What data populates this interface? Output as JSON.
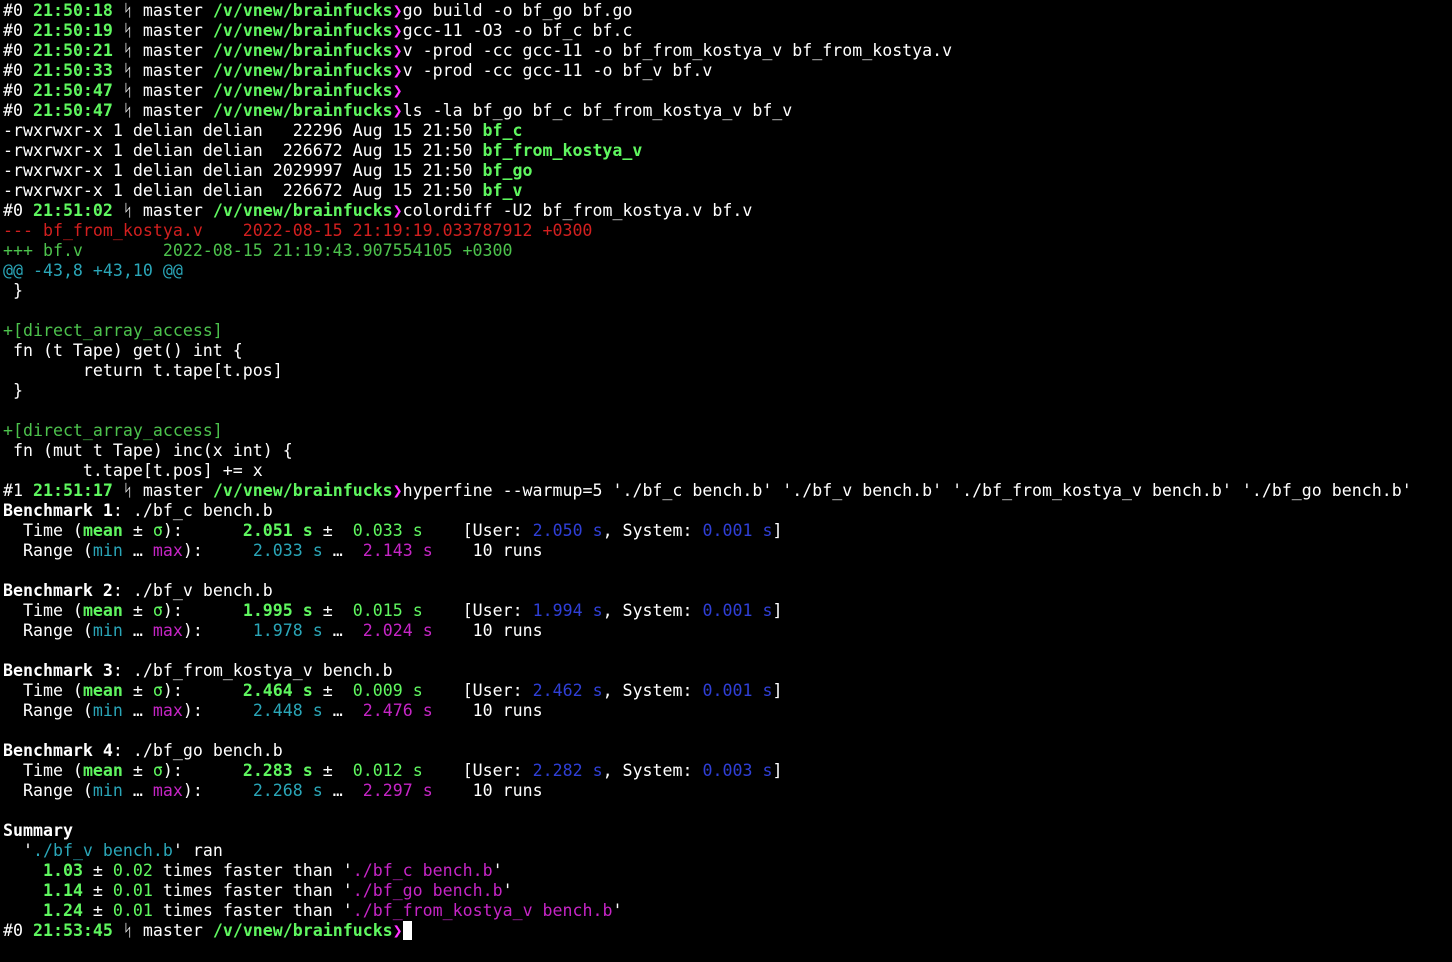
{
  "prompt": {
    "branch_icon": "ᛋ",
    "branch": "master",
    "path": "/v/vnew/brainfucks",
    "arrow": "❯"
  },
  "cmd1": {
    "num": "#0",
    "time": "21:50:18",
    "cmd": "go build -o bf_go bf.go"
  },
  "cmd2": {
    "num": "#0",
    "time": "21:50:19",
    "cmd": "gcc-11 -O3 -o bf_c bf.c"
  },
  "cmd3": {
    "num": "#0",
    "time": "21:50:21",
    "cmd": "v -prod -cc gcc-11 -o bf_from_kostya_v bf_from_kostya.v"
  },
  "cmd4": {
    "num": "#0",
    "time": "21:50:33",
    "cmd": "v -prod -cc gcc-11 -o bf_v bf.v"
  },
  "cmd5": {
    "num": "#0",
    "time": "21:50:47",
    "cmd": ""
  },
  "cmd6": {
    "num": "#0",
    "time": "21:50:47",
    "cmd": "ls -la bf_go bf_c bf_from_kostya_v bf_v"
  },
  "ls": [
    {
      "meta": "-rwxrwxr-x 1 delian delian   22296 Aug 15 21:50 ",
      "name": "bf_c"
    },
    {
      "meta": "-rwxrwxr-x 1 delian delian  226672 Aug 15 21:50 ",
      "name": "bf_from_kostya_v"
    },
    {
      "meta": "-rwxrwxr-x 1 delian delian 2029997 Aug 15 21:50 ",
      "name": "bf_go"
    },
    {
      "meta": "-rwxrwxr-x 1 delian delian  226672 Aug 15 21:50 ",
      "name": "bf_v"
    }
  ],
  "cmd7": {
    "num": "#0",
    "time": "21:51:02",
    "cmd": "colordiff -U2 bf_from_kostya.v bf.v"
  },
  "diff": {
    "minus": "--- bf_from_kostya.v    2022-08-15 21:19:19.033787912 +0300",
    "plus": "+++ bf.v        2022-08-15 21:19:43.907554105 +0300",
    "hunk": "@@ -43,8 +43,10 @@",
    "l1": " }",
    "l2": "",
    "add1": "+[direct_array_access]",
    "l3": " fn (t Tape) get() int {",
    "l4": "        return t.tape[t.pos]",
    "l5": " }",
    "l6": "",
    "add2": "+[direct_array_access]",
    "l7": " fn (mut t Tape) inc(x int) {",
    "l8": "        t.tape[t.pos] += x"
  },
  "cmd8": {
    "num": "#1",
    "time": "21:51:17",
    "cmd": "hyperfine --warmup=5 './bf_c bench.b' './bf_v bench.b' './bf_from_kostya_v bench.b' './bf_go bench.b'"
  },
  "bench_labels": {
    "benchmark": "Benchmark",
    "time": "  Time (",
    "mean": "mean",
    "pm": " ± ",
    "sigma": "σ",
    "close": "):",
    "range": "  Range (",
    "min": "min",
    "ell": " … ",
    "max": "max",
    "user": "[User: ",
    "system": ", System: ",
    "unit": "s",
    "runs": "runs"
  },
  "benchmarks": [
    {
      "n": "1",
      "cmd": "./bf_c bench.b",
      "mean": "2.051",
      "sigma": "0.033",
      "user": "2.050",
      "system": "0.001",
      "min": "2.033",
      "max": "2.143",
      "runs": "10"
    },
    {
      "n": "2",
      "cmd": "./bf_v bench.b",
      "mean": "1.995",
      "sigma": "0.015",
      "user": "1.994",
      "system": "0.001",
      "min": "1.978",
      "max": "2.024",
      "runs": "10"
    },
    {
      "n": "3",
      "cmd": "./bf_from_kostya_v bench.b",
      "mean": "2.464",
      "sigma": "0.009",
      "user": "2.462",
      "system": "0.001",
      "min": "2.448",
      "max": "2.476",
      "runs": "10"
    },
    {
      "n": "4",
      "cmd": "./bf_go bench.b",
      "mean": "2.283",
      "sigma": "0.012",
      "user": "2.282",
      "system": "0.003",
      "min": "2.268",
      "max": "2.297",
      "runs": "10"
    }
  ],
  "summary": {
    "title": "Summary",
    "winner": "./bf_v bench.b",
    "ran": "ran",
    "faster": "times faster than",
    "rows": [
      {
        "ratio": "1.03",
        "err": "0.02",
        "target": "./bf_c bench.b"
      },
      {
        "ratio": "1.14",
        "err": "0.01",
        "target": "./bf_go bench.b"
      },
      {
        "ratio": "1.24",
        "err": "0.01",
        "target": "./bf_from_kostya_v bench.b"
      }
    ]
  },
  "cmd9": {
    "num": "#0",
    "time": "21:53:45",
    "cmd": ""
  }
}
